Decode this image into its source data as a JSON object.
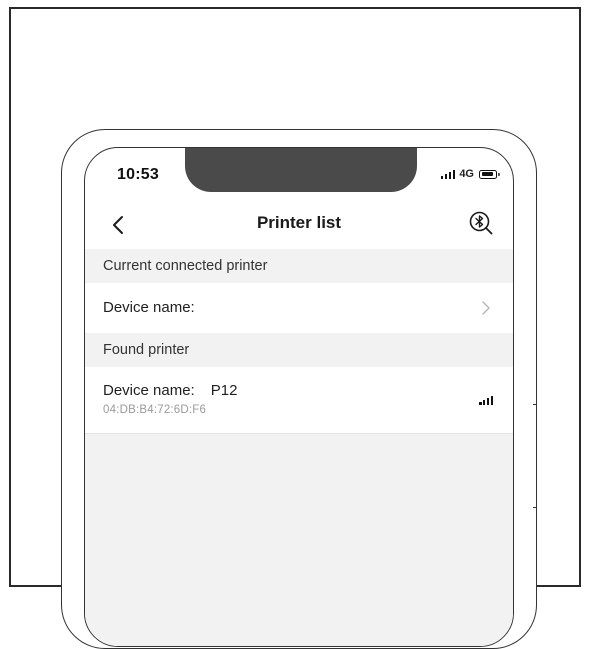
{
  "status_bar": {
    "time": "10:53",
    "network": "4G",
    "signal_icon": "signal-bars-icon",
    "battery_icon": "battery-icon"
  },
  "nav": {
    "title": "Printer list",
    "back_icon": "chevron-left-icon",
    "action_icon": "bluetooth-search-icon"
  },
  "sections": {
    "connected": {
      "header": "Current connected printer",
      "row_label": "Device name:",
      "row_icon": "chevron-right-icon"
    },
    "found": {
      "header": "Found printer",
      "devices": [
        {
          "label": "Device name:",
          "name": "P12",
          "mac": "04:DB:B4:72:6D:F6",
          "signal_icon": "signal-strength-icon"
        }
      ]
    }
  },
  "colors": {
    "section_background": "#f2f2f2",
    "notch": "#4a4a4a",
    "mac_text": "#9a9a9a"
  }
}
